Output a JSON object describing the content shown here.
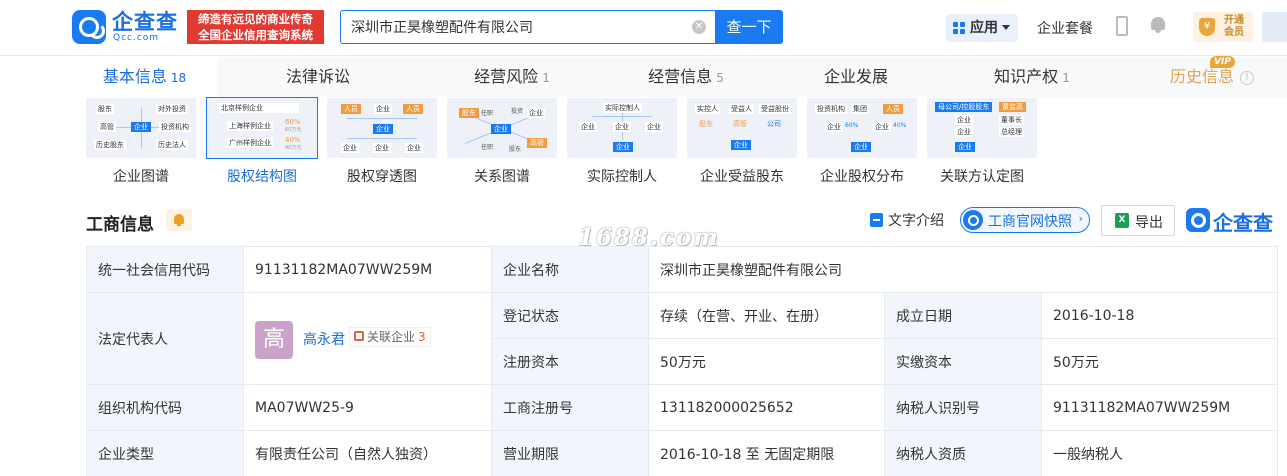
{
  "header": {
    "logo_text": "企查查",
    "logo_sub": "Qcc.com",
    "slogan_line1": "缔造有远见的商业传奇",
    "slogan_line2": "全国企业信用查询系统",
    "search_value": "深圳市正昊橡塑配件有限公司",
    "search_button": "查一下",
    "apps_label": "应用",
    "suite_label": "企业套餐",
    "vip_line1": "开通",
    "vip_line2": "会员",
    "vip_shield_glyph": "¥"
  },
  "nav": {
    "tabs": [
      {
        "label": "基本信息",
        "count": "18"
      },
      {
        "label": "法律诉讼",
        "count": ""
      },
      {
        "label": "经营风险",
        "count": "1"
      },
      {
        "label": "经营信息",
        "count": "5"
      },
      {
        "label": "企业发展",
        "count": ""
      },
      {
        "label": "知识产权",
        "count": "1"
      },
      {
        "label": "历史信息",
        "count": ""
      }
    ],
    "vip_tag": "VIP",
    "info_glyph": "!"
  },
  "cards": [
    {
      "label": "企业图谱",
      "thumb": [
        "股东",
        "对外投资",
        "高管",
        "企业",
        "投资机构",
        "历史股东",
        "历史法人"
      ]
    },
    {
      "label": "股权结构图",
      "thumb": [
        "北京样例企业",
        "上海样例企业",
        "广州样例企业",
        "60%",
        "60万元",
        "40%",
        "40万元"
      ]
    },
    {
      "label": "股权穿透图",
      "thumb": [
        "人员",
        "企业",
        "人员",
        "企业",
        "企业",
        "企业",
        "企业"
      ]
    },
    {
      "label": "关系图谱",
      "thumb": [
        "股东",
        "任职",
        "投资",
        "企业",
        "企业",
        "任职",
        "股东",
        "高管"
      ]
    },
    {
      "label": "实际控制人",
      "thumb": [
        "实际控制人",
        "企业",
        "企业",
        "企业",
        "企业"
      ]
    },
    {
      "label": "企业受益股东",
      "thumb": [
        "实控人",
        "受益人",
        "受益股份",
        "股东",
        "高管",
        "公司",
        "企业"
      ]
    },
    {
      "label": "企业股权分布",
      "thumb": [
        "投资机构",
        "集团",
        "人员",
        "企业",
        "60%",
        "企业",
        "40%",
        "企业"
      ]
    },
    {
      "label": "关联方认定图",
      "thumb": [
        "母公司/控股股东",
        "董监高",
        "企业",
        "董事长",
        "企业",
        "总经理",
        "企业"
      ]
    }
  ],
  "section": {
    "title": "工商信息",
    "watermark": "1688.com",
    "text_intro": "文字介绍",
    "snapshot": "工商官网快照",
    "snapshot_arrow": "›",
    "export": "导出",
    "excel_glyph": "X",
    "brand": "企查查"
  },
  "info": {
    "credit_code_label": "统一社会信用代码",
    "credit_code": "91131182MA07WW259M",
    "company_name_label": "企业名称",
    "company_name": "深圳市正昊橡塑配件有限公司",
    "legal_rep_label": "法定代表人",
    "legal_rep_avatar": "高",
    "legal_rep_name": "高永君",
    "related_label": "关联企业",
    "related_count": "3",
    "status_label": "登记状态",
    "status": "存续（在营、开业、在册）",
    "found_date_label": "成立日期",
    "found_date": "2016-10-18",
    "reg_capital_label": "注册资本",
    "reg_capital": "50万元",
    "paid_capital_label": "实缴资本",
    "paid_capital": "50万元",
    "org_code_label": "组织机构代码",
    "org_code": "MA07WW25-9",
    "reg_no_label": "工商注册号",
    "reg_no": "131182000025652",
    "taxpayer_id_label": "纳税人识别号",
    "taxpayer_id": "91131182MA07WW259M",
    "type_label": "企业类型",
    "type": "有限责任公司（自然人独资）",
    "term_label": "营业期限",
    "term": "2016-10-18 至 无固定期限",
    "taxpayer_qual_label": "纳税人资质",
    "taxpayer_qual": "一般纳税人"
  }
}
